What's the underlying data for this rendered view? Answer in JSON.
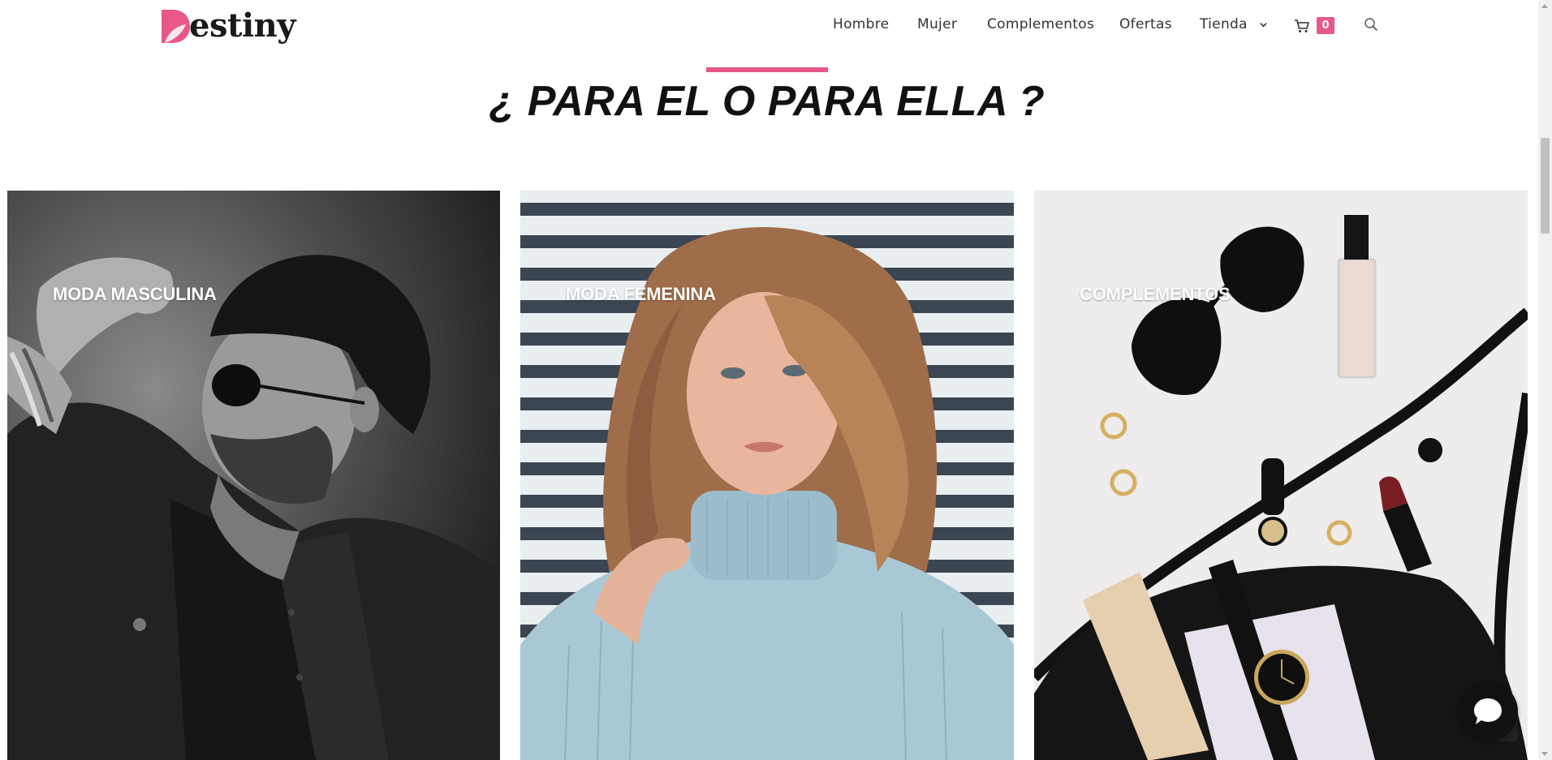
{
  "header": {
    "logo_text": "estiny",
    "logo_letter": "D",
    "nav": [
      {
        "label": "Hombre"
      },
      {
        "label": "Mujer"
      },
      {
        "label": "Complementos"
      },
      {
        "label": "Ofertas"
      },
      {
        "label": "Tienda",
        "has_dropdown": true
      }
    ],
    "cart_count": "0",
    "accent_color": "#e8578a"
  },
  "section": {
    "title": "¿ PARA EL O PARA ELLA ?"
  },
  "categories": [
    {
      "label": "MODA MASCULINA",
      "image": "man-with-sunglasses-bw-photo"
    },
    {
      "label": "MODA FEMENINA",
      "image": "woman-in-turtleneck-photo"
    },
    {
      "label": "COMPLEMENTOS",
      "image": "accessories-flatlay-photo"
    }
  ],
  "icons": {
    "cart": "cart-icon",
    "search": "search-icon",
    "chat": "chat-icon",
    "chevron": "chevron-down-icon"
  }
}
